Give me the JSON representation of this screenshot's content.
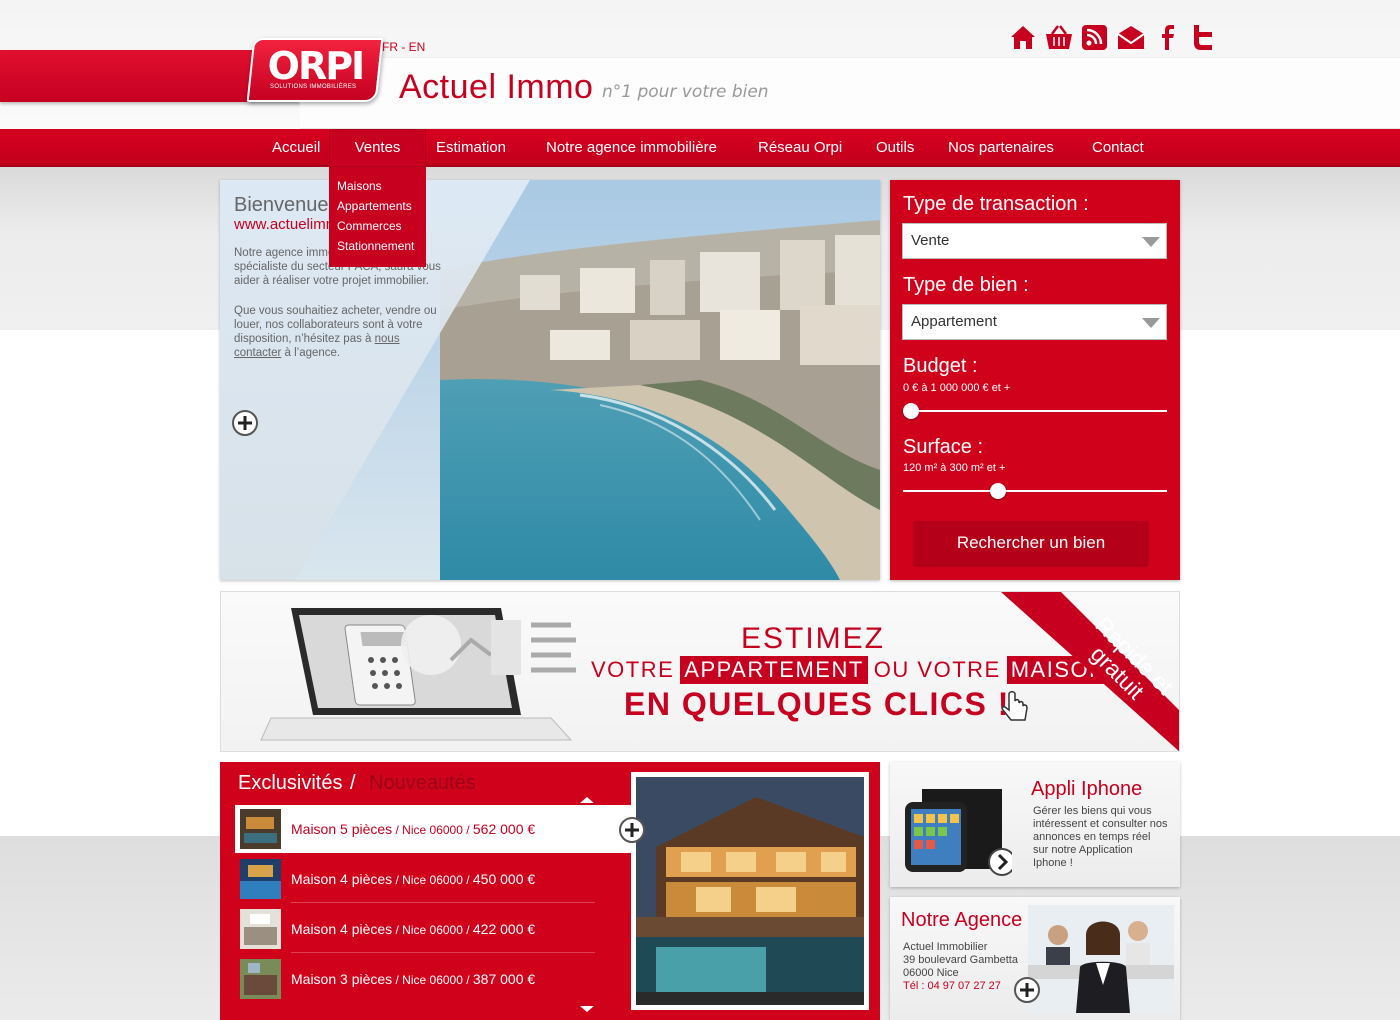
{
  "header": {
    "logo_text": "ORPI",
    "logo_sub": "SOLUTIONS IMMOBILIÈRES",
    "lang": "FR - EN",
    "title": "Actuel Immo",
    "tagline": "n°1 pour votre bien",
    "icons": [
      "home-icon",
      "basket-icon",
      "rss-icon",
      "mail-icon",
      "facebook-icon",
      "twitter-icon"
    ]
  },
  "nav": {
    "items": [
      "Accueil",
      "Ventes",
      "Estimation",
      "Notre agence immobilière",
      "Réseau Orpi",
      "Outils",
      "Nos partenaires",
      "Contact"
    ],
    "active": "Ventes",
    "dropdown": [
      "Maisons",
      "Appartements",
      "Commerces",
      "Stationnement"
    ]
  },
  "hero": {
    "welcome": "Bienvenue",
    "url": "www.actuelimmo.fr",
    "p1": "Notre agence immobilière de Nice, spécialiste du secteur PACA, saura vous aider à réaliser votre projet immobilier.",
    "p2_before": "Que vous souhaitiez acheter, vendre ou louer, nos collaborateurs sont à votre disposition, n’hésitez  pas à ",
    "p2_link": "nous contacter",
    "p2_after": " à l’agence."
  },
  "search": {
    "transaction_label": "Type de transaction :",
    "transaction_value": "Vente",
    "property_label": "Type de bien :",
    "property_value": "Appartement",
    "budget_label": "Budget :",
    "budget_range": "0 € à 1 000 000 € et +",
    "budget_level": 0,
    "surface_label": "Surface :",
    "surface_range": "120 m² à 300 m² et +",
    "surface_level": 0.35,
    "button": "Rechercher un bien"
  },
  "banner": {
    "line1": "ESTIMEZ",
    "line2_a": "VOTRE",
    "line2_b": "APPARTEMENT",
    "line2_c": "OU VOTRE",
    "line2_d": "MAISON",
    "line3": "EN QUELQUES CLICS !",
    "ribbon": "Rapide et gratuit"
  },
  "listings": {
    "tab_active": "Exclusivités",
    "separator": "/",
    "tab_inactive": "Nouveautés",
    "items": [
      {
        "title": "Maison 5 pièces",
        "detail": " / Nice 06000 / ",
        "price": "562 000 €"
      },
      {
        "title": "Maison 4 pièces",
        "detail": " / Nice 06000 / ",
        "price": "450 000 €"
      },
      {
        "title": "Maison 4 pièces",
        "detail": " / Nice 06000 / ",
        "price": "422 000 €"
      },
      {
        "title": "Maison 3 pièces",
        "detail": " / Nice 06000 / ",
        "price": "387 000 €"
      }
    ]
  },
  "app": {
    "title": "Appli Iphone",
    "text": "Gérer les biens qui vous intéressent et consulter nos annonces en temps réel sur notre Application Iphone !"
  },
  "agency": {
    "title": "Notre Agence",
    "name": "Actuel Immobilier",
    "street": "39 boulevard Gambetta",
    "city": "06000 Nice",
    "phone": "Tél : 04 97 07 27 27"
  },
  "colors": {
    "brand_red": "#d0021b",
    "dark_red": "#b40018"
  }
}
